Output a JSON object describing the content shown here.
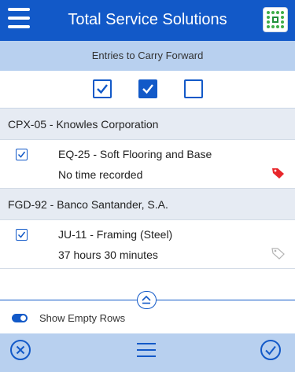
{
  "header": {
    "title": "Total Service Solutions",
    "menu_icon": "hamburger-menu-icon",
    "logo_icon": "app-logo-icon"
  },
  "subheader": {
    "label": "Entries to Carry Forward"
  },
  "filters": [
    {
      "name": "outline-checked",
      "checked": true
    },
    {
      "name": "filled-checked",
      "checked": true
    },
    {
      "name": "unchecked",
      "checked": false
    }
  ],
  "groups": [
    {
      "label": "CPX-05 - Knowles Corporation",
      "entries": [
        {
          "title": "EQ-25 - Soft Flooring and Base",
          "time": "No time recorded",
          "checked": true,
          "tag": "tag-red-icon"
        }
      ]
    },
    {
      "label": "FGD-92 - Banco Santander, S.A.",
      "entries": [
        {
          "title": "JU-11 - Framing (Steel)",
          "time": "37 hours 30 minutes",
          "checked": true,
          "tag": "tag-outline-icon"
        }
      ]
    }
  ],
  "toggle": {
    "label": "Show Empty Rows",
    "on": true
  },
  "footer": {
    "cancel_icon": "cancel-circle-icon",
    "menu_icon": "list-menu-icon",
    "confirm_icon": "check-circle-icon"
  },
  "colors": {
    "primary": "#1259c8",
    "light_blue": "#b8d0ef",
    "group_bg": "#e6ebf3",
    "tag_red": "#e8262b",
    "tag_gray": "#b5b5b5"
  }
}
